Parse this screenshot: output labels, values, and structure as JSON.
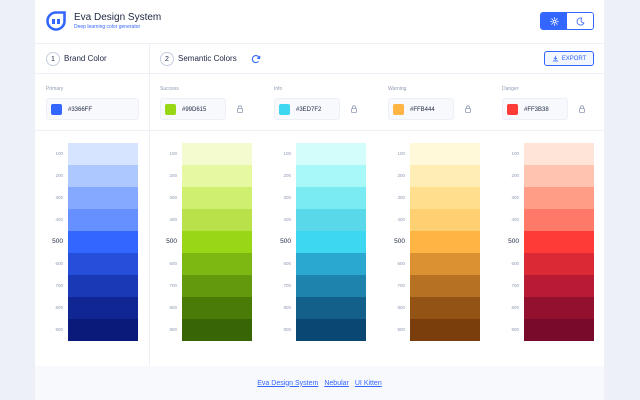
{
  "header": {
    "title": "Eva Design System",
    "subtitle": "Deep learning color generator",
    "logo_icon": "eva-logo-icon",
    "theme_light_icon": "sun-icon",
    "theme_dark_icon": "moon-icon",
    "active_theme": "light"
  },
  "sections": {
    "brand": {
      "number": "1",
      "title": "Brand Color"
    },
    "semantic": {
      "number": "2",
      "title": "Semantic Colors",
      "refresh_icon": "refresh-icon"
    },
    "export_label": "EXPORT",
    "export_icon": "download-icon"
  },
  "colors": {
    "primary": {
      "label": "Primary",
      "hex": "#3366FF"
    },
    "success": {
      "label": "Success",
      "hex": "#99D615"
    },
    "info": {
      "label": "Info",
      "hex": "#3ED7F2"
    },
    "warning": {
      "label": "Warning",
      "hex": "#FFB444"
    },
    "danger": {
      "label": "Danger",
      "hex": "#FF3B38"
    }
  },
  "shade_labels": [
    "100",
    "200",
    "300",
    "400",
    "500",
    "600",
    "700",
    "800",
    "900"
  ],
  "palettes": {
    "primary": [
      "#d6e4ff",
      "#adc8ff",
      "#84a9ff",
      "#6690ff",
      "#3366ff",
      "#254edb",
      "#1939b7",
      "#102693",
      "#091a7a"
    ],
    "success": [
      "#f4fccf",
      "#e6f9a1",
      "#cff06f",
      "#b8e14a",
      "#99d615",
      "#7db812",
      "#63990c",
      "#4a7b07",
      "#396605"
    ],
    "info": [
      "#d3fdfb",
      "#a7f9f9",
      "#7aeaf3",
      "#58d8e8",
      "#3ed7f2",
      "#2ba8cf",
      "#1e83ad",
      "#13618b",
      "#0b4773"
    ],
    "warning": [
      "#fff8d9",
      "#ffedb3",
      "#ffdf8e",
      "#ffd072",
      "#ffb444",
      "#db9131",
      "#b77122",
      "#935315",
      "#7a3e0d"
    ],
    "danger": [
      "#ffe4d7",
      "#ffc4af",
      "#ff9d87",
      "#ff7969",
      "#ff3b38",
      "#db2936",
      "#b71c34",
      "#93112f",
      "#7a0a2c"
    ]
  },
  "footer": {
    "links": [
      "Eva Design System",
      "Nebular",
      "UI Kitten"
    ]
  }
}
